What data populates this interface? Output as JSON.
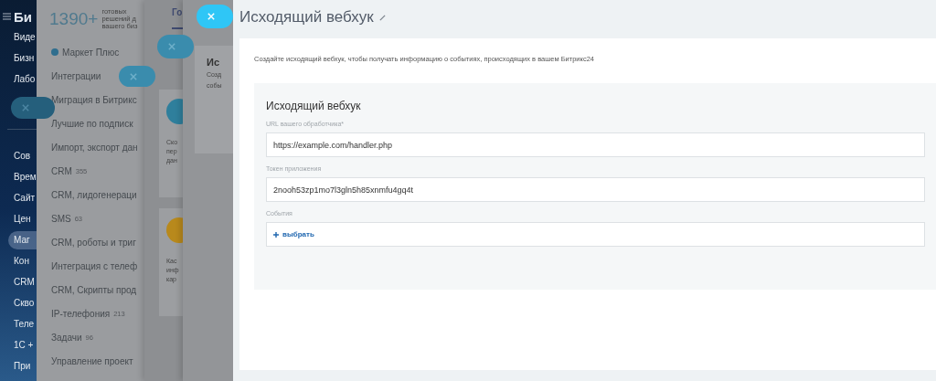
{
  "left_nav": {
    "title": "Би",
    "items_top": [
      {
        "label": "Виде"
      },
      {
        "label": "Бизн"
      },
      {
        "label": "Лабо"
      }
    ],
    "items": [
      {
        "label": "Сов",
        "selected": false
      },
      {
        "label": "Врем",
        "selected": false
      },
      {
        "label": "Сайт",
        "selected": false
      },
      {
        "label": "Цен",
        "selected": false
      },
      {
        "label": "Маг",
        "selected": true
      },
      {
        "label": "Кон",
        "selected": false
      },
      {
        "label": "CRM",
        "selected": false
      },
      {
        "label": "Скво",
        "selected": false
      },
      {
        "label": "Теле",
        "selected": false
      },
      {
        "label": "1С +",
        "selected": false
      },
      {
        "label": "При",
        "selected": false
      }
    ]
  },
  "market_panel": {
    "count": "1390+",
    "caption": [
      "готовых",
      "решений д",
      "вашего биз"
    ],
    "items": [
      {
        "label": "Маркет Плюс",
        "kind": "featured"
      },
      {
        "label": "Интеграции",
        "kind": "plain"
      },
      {
        "label": "Миграция в Битрикс",
        "kind": "plain"
      },
      {
        "label": "Лучшие по подписк",
        "kind": "plain"
      },
      {
        "label": "Импорт, экспорт дан",
        "kind": "plain"
      },
      {
        "label": "CRM",
        "count": "355",
        "kind": "plain"
      },
      {
        "label": "CRM, лидогенераци",
        "kind": "plain"
      },
      {
        "label": "SMS",
        "count": "63",
        "kind": "plain"
      },
      {
        "label": "CRM, роботы и триг",
        "kind": "plain"
      },
      {
        "label": "Интеграция с телеф",
        "kind": "plain"
      },
      {
        "label": "CRM, Скрипты прод",
        "kind": "plain"
      },
      {
        "label": "IP-телефония",
        "count": "213",
        "kind": "plain"
      },
      {
        "label": "Задачи",
        "count": "96",
        "kind": "plain"
      },
      {
        "label": "Управление проект",
        "kind": "plain"
      }
    ]
  },
  "apps_panel": {
    "tab": "Го",
    "cards": [
      {
        "lines": [
          "Ско",
          "пер",
          "дан"
        ],
        "color": "#2f7f9c"
      },
      {
        "lines": [
          "Кас",
          "инф",
          "кар"
        ],
        "color": "#b8891c"
      }
    ]
  },
  "webhook_panel": {
    "card_title": "Ис",
    "card_lines": [
      "Созд",
      "собы"
    ]
  },
  "slider": {
    "title": "Исходящий вебхук",
    "description": "Создайте исходящий вебхук, чтобы получать информацию о событиях, происходящих в вашем Битрикс24",
    "form": {
      "title": "Исходящий вебхук",
      "fields": [
        {
          "label": "URL вашего обработчика*",
          "value": "https://example.com/handler.php",
          "kind": "input"
        },
        {
          "label": "Токен приложения",
          "value": "2nooh53zp1mo7l3gln5h85xnmfu4gq4t",
          "kind": "input"
        },
        {
          "label": "События",
          "value": "выбрать",
          "kind": "picker"
        }
      ]
    }
  }
}
